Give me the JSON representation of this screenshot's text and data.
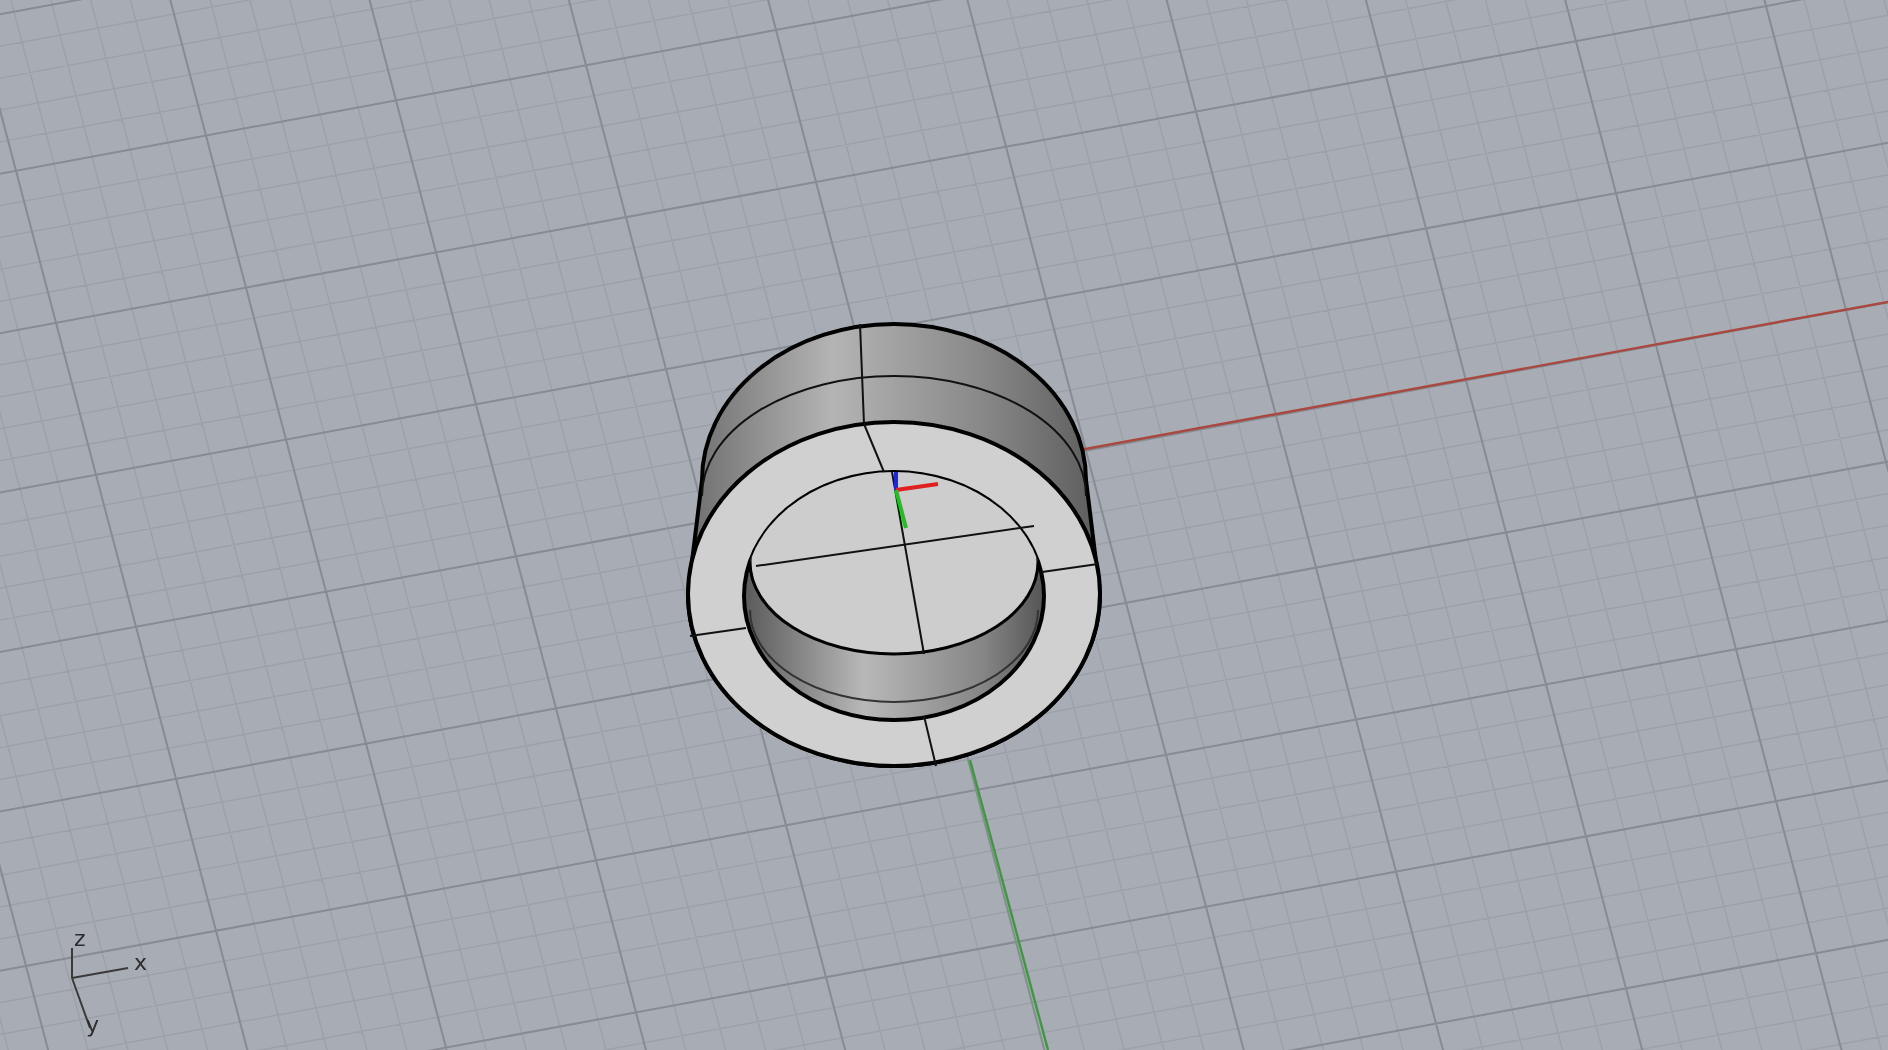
{
  "axis_labels": [
    {
      "text": "z"
    },
    {
      "text": "x"
    },
    {
      "text": "y"
    }
  ]
}
